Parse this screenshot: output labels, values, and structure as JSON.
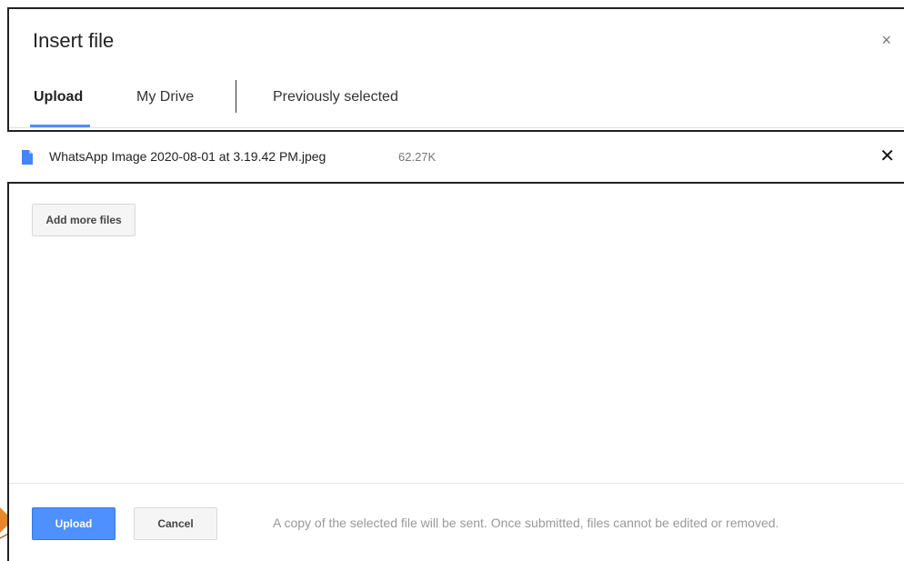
{
  "dialog": {
    "title": "Insert file",
    "close_symbol": "×"
  },
  "tabs": [
    {
      "label": "Upload",
      "active": true
    },
    {
      "label": "My Drive",
      "active": false
    },
    {
      "label": "Previously selected",
      "active": false
    }
  ],
  "file": {
    "name": "WhatsApp Image 2020-08-01 at 3.19.42 PM.jpeg",
    "size": "62.27K",
    "remove_symbol": "✕",
    "icon": "file-doc-icon"
  },
  "actions": {
    "add_more_label": "Add more files",
    "upload_label": "Upload",
    "cancel_label": "Cancel"
  },
  "footer": {
    "note": "A copy of the selected file will be sent. Once submitted, files cannot be edited or removed."
  },
  "colors": {
    "accent": "#4d90fe",
    "file_icon": "#4285f4",
    "pointer": "#e8872a"
  }
}
